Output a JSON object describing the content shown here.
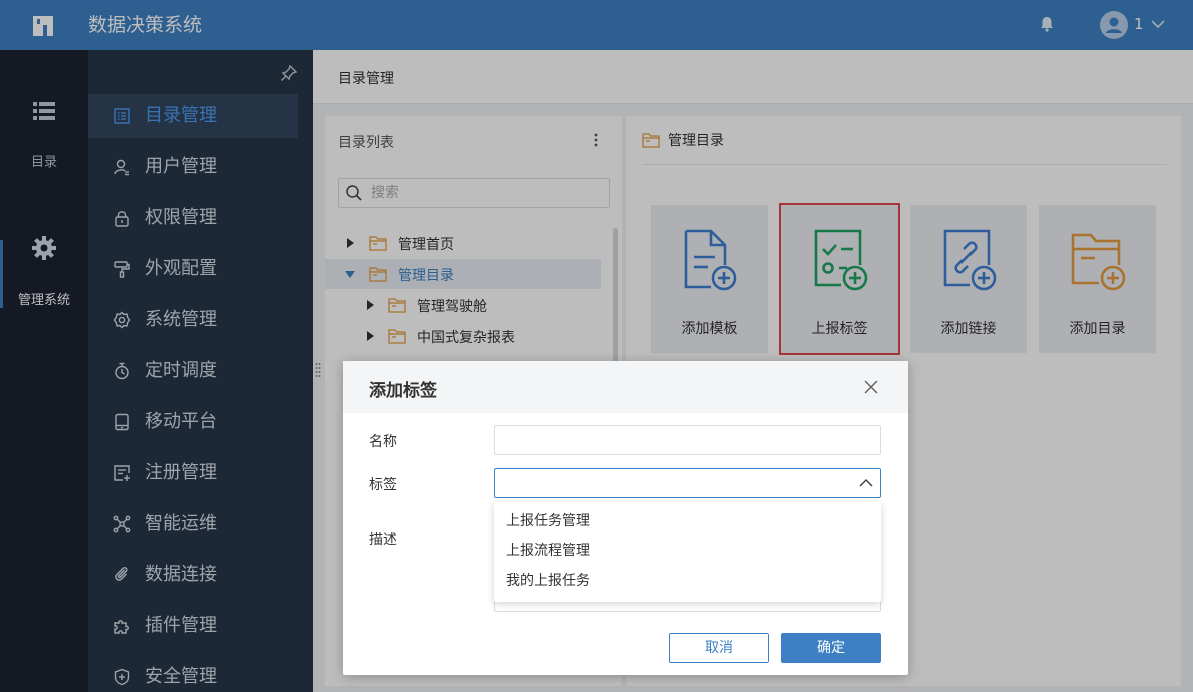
{
  "app": {
    "title": "数据决策系统",
    "user": "1"
  },
  "rail": {
    "items": [
      {
        "label": "目录"
      },
      {
        "label": "管理系统"
      }
    ]
  },
  "nav": {
    "items": [
      {
        "label": "目录管理",
        "icon": "list-icon"
      },
      {
        "label": "用户管理",
        "icon": "user-icon"
      },
      {
        "label": "权限管理",
        "icon": "lock-icon"
      },
      {
        "label": "外观配置",
        "icon": "paint-roller-icon"
      },
      {
        "label": "系统管理",
        "icon": "gear-icon"
      },
      {
        "label": "定时调度",
        "icon": "timer-icon"
      },
      {
        "label": "移动平台",
        "icon": "tablet-icon"
      },
      {
        "label": "注册管理",
        "icon": "register-icon"
      },
      {
        "label": "智能运维",
        "icon": "nodes-icon"
      },
      {
        "label": "数据连接",
        "icon": "link-icon"
      },
      {
        "label": "插件管理",
        "icon": "puzzle-icon"
      },
      {
        "label": "安全管理",
        "icon": "shield-icon"
      }
    ]
  },
  "breadcrumb": "目录管理",
  "tree": {
    "title": "目录列表",
    "search_placeholder": "搜索",
    "rows": [
      {
        "label": "管理首页"
      },
      {
        "label": "管理目录"
      },
      {
        "label": "管理驾驶舱"
      },
      {
        "label": "中国式复杂报表"
      }
    ]
  },
  "right": {
    "title": "管理目录",
    "cards": [
      {
        "label": "添加模板"
      },
      {
        "label": "上报标签"
      },
      {
        "label": "添加链接"
      },
      {
        "label": "添加目录"
      }
    ]
  },
  "dialog": {
    "title": "添加标签",
    "name_label": "名称",
    "name_value": "",
    "tag_label": "标签",
    "tag_value": "",
    "desc_label": "描述",
    "options": [
      "上报任务管理",
      "上报流程管理",
      "我的上报任务"
    ],
    "cancel": "取消",
    "ok": "确定"
  },
  "colors": {
    "topbar": "#3d80c4",
    "nav": "#28374b",
    "rail": "#1c2330",
    "highlight": "#e2484b",
    "accent": "#3d80c4"
  }
}
